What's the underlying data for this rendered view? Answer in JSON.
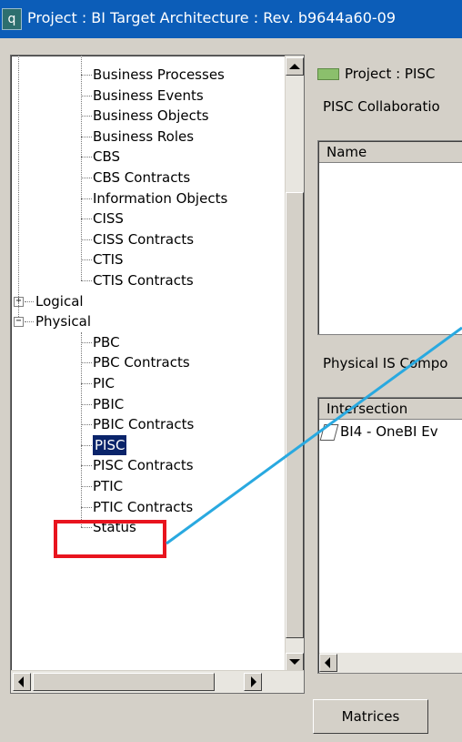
{
  "window": {
    "title": "Project : BI Target Architecture : Rev. b9644a60-09",
    "app_icon_glyph": "q"
  },
  "tree": {
    "items": [
      {
        "label": "Business Processes",
        "level": 2
      },
      {
        "label": "Business Events",
        "level": 2
      },
      {
        "label": "Business Objects",
        "level": 2
      },
      {
        "label": "Business Roles",
        "level": 2
      },
      {
        "label": "CBS",
        "level": 2
      },
      {
        "label": "CBS Contracts",
        "level": 2
      },
      {
        "label": "Information Objects",
        "level": 2
      },
      {
        "label": "CISS",
        "level": 2
      },
      {
        "label": "CISS Contracts",
        "level": 2
      },
      {
        "label": "CTIS",
        "level": 2
      },
      {
        "label": "CTIS Contracts",
        "level": 2
      },
      {
        "label": "Logical",
        "level": 1,
        "expander": "+"
      },
      {
        "label": "Physical",
        "level": 1,
        "expander": "−"
      },
      {
        "label": "PBC",
        "level": 2
      },
      {
        "label": "PBC Contracts",
        "level": 2
      },
      {
        "label": "PIC",
        "level": 2
      },
      {
        "label": "PBIC",
        "level": 2
      },
      {
        "label": "PBIC Contracts",
        "level": 2
      },
      {
        "label": "PISC",
        "level": 2,
        "selected": true
      },
      {
        "label": "PISC Contracts",
        "level": 2
      },
      {
        "label": "PTIC",
        "level": 2
      },
      {
        "label": "PTIC Contracts",
        "level": 2
      },
      {
        "label": "Status",
        "level": 2
      }
    ]
  },
  "right": {
    "project_label": "Project : PISC",
    "collab_label": "PISC Collaboratio",
    "name_column": "Name",
    "physical_label": "Physical IS Compo",
    "intersection_column": "Intersection",
    "row_item": "BI4 - OneBI Ev"
  },
  "bottom": {
    "matrices_button": "Matrices"
  },
  "colors": {
    "titlebar": "#0c5db8",
    "selection": "#0a246a",
    "highlight_box": "#e8141e",
    "connector_line": "#29a9e0"
  }
}
